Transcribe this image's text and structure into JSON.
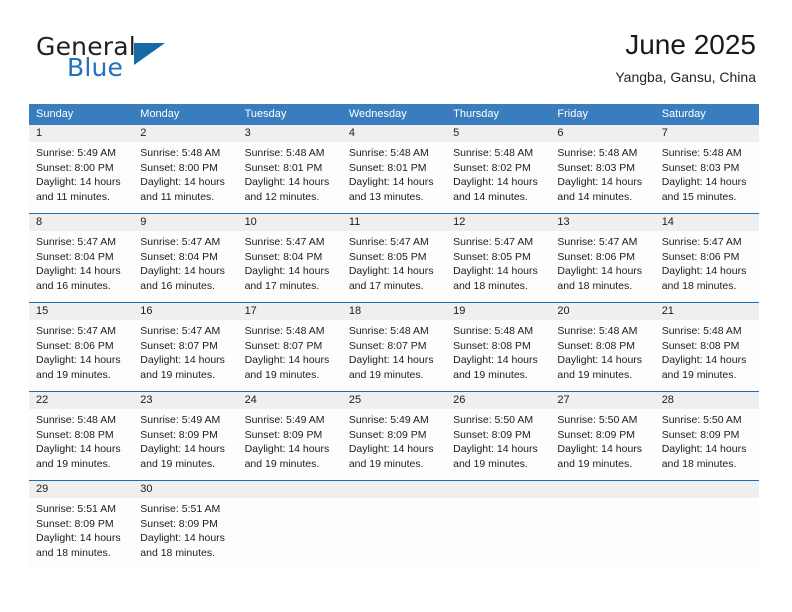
{
  "brand": {
    "name_part1": "General",
    "name_part2": "Blue",
    "triangle_icon": "triangle-icon",
    "colors": {
      "general": "#221f1f",
      "blue": "#2272bb",
      "triangle": "#1769a8"
    }
  },
  "header": {
    "title": "June 2025",
    "subtitle": "Yangba, Gansu, China"
  },
  "theme": {
    "header_blue": "#3a7dbf",
    "row_divider_blue": "#1f6cb0",
    "day_band_gray": "#efefef",
    "cell_white": "#fdfdfd",
    "text": "#1c1c1c"
  },
  "weekdays": [
    "Sunday",
    "Monday",
    "Tuesday",
    "Wednesday",
    "Thursday",
    "Friday",
    "Saturday"
  ],
  "weeks": [
    [
      {
        "day": "1",
        "lines": [
          "Sunrise: 5:49 AM",
          "Sunset: 8:00 PM",
          "Daylight: 14 hours",
          "and 11 minutes."
        ]
      },
      {
        "day": "2",
        "lines": [
          "Sunrise: 5:48 AM",
          "Sunset: 8:00 PM",
          "Daylight: 14 hours",
          "and 11 minutes."
        ]
      },
      {
        "day": "3",
        "lines": [
          "Sunrise: 5:48 AM",
          "Sunset: 8:01 PM",
          "Daylight: 14 hours",
          "and 12 minutes."
        ]
      },
      {
        "day": "4",
        "lines": [
          "Sunrise: 5:48 AM",
          "Sunset: 8:01 PM",
          "Daylight: 14 hours",
          "and 13 minutes."
        ]
      },
      {
        "day": "5",
        "lines": [
          "Sunrise: 5:48 AM",
          "Sunset: 8:02 PM",
          "Daylight: 14 hours",
          "and 14 minutes."
        ]
      },
      {
        "day": "6",
        "lines": [
          "Sunrise: 5:48 AM",
          "Sunset: 8:03 PM",
          "Daylight: 14 hours",
          "and 14 minutes."
        ]
      },
      {
        "day": "7",
        "lines": [
          "Sunrise: 5:48 AM",
          "Sunset: 8:03 PM",
          "Daylight: 14 hours",
          "and 15 minutes."
        ]
      }
    ],
    [
      {
        "day": "8",
        "lines": [
          "Sunrise: 5:47 AM",
          "Sunset: 8:04 PM",
          "Daylight: 14 hours",
          "and 16 minutes."
        ]
      },
      {
        "day": "9",
        "lines": [
          "Sunrise: 5:47 AM",
          "Sunset: 8:04 PM",
          "Daylight: 14 hours",
          "and 16 minutes."
        ]
      },
      {
        "day": "10",
        "lines": [
          "Sunrise: 5:47 AM",
          "Sunset: 8:04 PM",
          "Daylight: 14 hours",
          "and 17 minutes."
        ]
      },
      {
        "day": "11",
        "lines": [
          "Sunrise: 5:47 AM",
          "Sunset: 8:05 PM",
          "Daylight: 14 hours",
          "and 17 minutes."
        ]
      },
      {
        "day": "12",
        "lines": [
          "Sunrise: 5:47 AM",
          "Sunset: 8:05 PM",
          "Daylight: 14 hours",
          "and 18 minutes."
        ]
      },
      {
        "day": "13",
        "lines": [
          "Sunrise: 5:47 AM",
          "Sunset: 8:06 PM",
          "Daylight: 14 hours",
          "and 18 minutes."
        ]
      },
      {
        "day": "14",
        "lines": [
          "Sunrise: 5:47 AM",
          "Sunset: 8:06 PM",
          "Daylight: 14 hours",
          "and 18 minutes."
        ]
      }
    ],
    [
      {
        "day": "15",
        "lines": [
          "Sunrise: 5:47 AM",
          "Sunset: 8:06 PM",
          "Daylight: 14 hours",
          "and 19 minutes."
        ]
      },
      {
        "day": "16",
        "lines": [
          "Sunrise: 5:47 AM",
          "Sunset: 8:07 PM",
          "Daylight: 14 hours",
          "and 19 minutes."
        ]
      },
      {
        "day": "17",
        "lines": [
          "Sunrise: 5:48 AM",
          "Sunset: 8:07 PM",
          "Daylight: 14 hours",
          "and 19 minutes."
        ]
      },
      {
        "day": "18",
        "lines": [
          "Sunrise: 5:48 AM",
          "Sunset: 8:07 PM",
          "Daylight: 14 hours",
          "and 19 minutes."
        ]
      },
      {
        "day": "19",
        "lines": [
          "Sunrise: 5:48 AM",
          "Sunset: 8:08 PM",
          "Daylight: 14 hours",
          "and 19 minutes."
        ]
      },
      {
        "day": "20",
        "lines": [
          "Sunrise: 5:48 AM",
          "Sunset: 8:08 PM",
          "Daylight: 14 hours",
          "and 19 minutes."
        ]
      },
      {
        "day": "21",
        "lines": [
          "Sunrise: 5:48 AM",
          "Sunset: 8:08 PM",
          "Daylight: 14 hours",
          "and 19 minutes."
        ]
      }
    ],
    [
      {
        "day": "22",
        "lines": [
          "Sunrise: 5:48 AM",
          "Sunset: 8:08 PM",
          "Daylight: 14 hours",
          "and 19 minutes."
        ]
      },
      {
        "day": "23",
        "lines": [
          "Sunrise: 5:49 AM",
          "Sunset: 8:09 PM",
          "Daylight: 14 hours",
          "and 19 minutes."
        ]
      },
      {
        "day": "24",
        "lines": [
          "Sunrise: 5:49 AM",
          "Sunset: 8:09 PM",
          "Daylight: 14 hours",
          "and 19 minutes."
        ]
      },
      {
        "day": "25",
        "lines": [
          "Sunrise: 5:49 AM",
          "Sunset: 8:09 PM",
          "Daylight: 14 hours",
          "and 19 minutes."
        ]
      },
      {
        "day": "26",
        "lines": [
          "Sunrise: 5:50 AM",
          "Sunset: 8:09 PM",
          "Daylight: 14 hours",
          "and 19 minutes."
        ]
      },
      {
        "day": "27",
        "lines": [
          "Sunrise: 5:50 AM",
          "Sunset: 8:09 PM",
          "Daylight: 14 hours",
          "and 19 minutes."
        ]
      },
      {
        "day": "28",
        "lines": [
          "Sunrise: 5:50 AM",
          "Sunset: 8:09 PM",
          "Daylight: 14 hours",
          "and 18 minutes."
        ]
      }
    ],
    [
      {
        "day": "29",
        "lines": [
          "Sunrise: 5:51 AM",
          "Sunset: 8:09 PM",
          "Daylight: 14 hours",
          "and 18 minutes."
        ]
      },
      {
        "day": "30",
        "lines": [
          "Sunrise: 5:51 AM",
          "Sunset: 8:09 PM",
          "Daylight: 14 hours",
          "and 18 minutes."
        ]
      },
      {
        "day": "",
        "lines": []
      },
      {
        "day": "",
        "lines": []
      },
      {
        "day": "",
        "lines": []
      },
      {
        "day": "",
        "lines": []
      },
      {
        "day": "",
        "lines": []
      }
    ]
  ]
}
